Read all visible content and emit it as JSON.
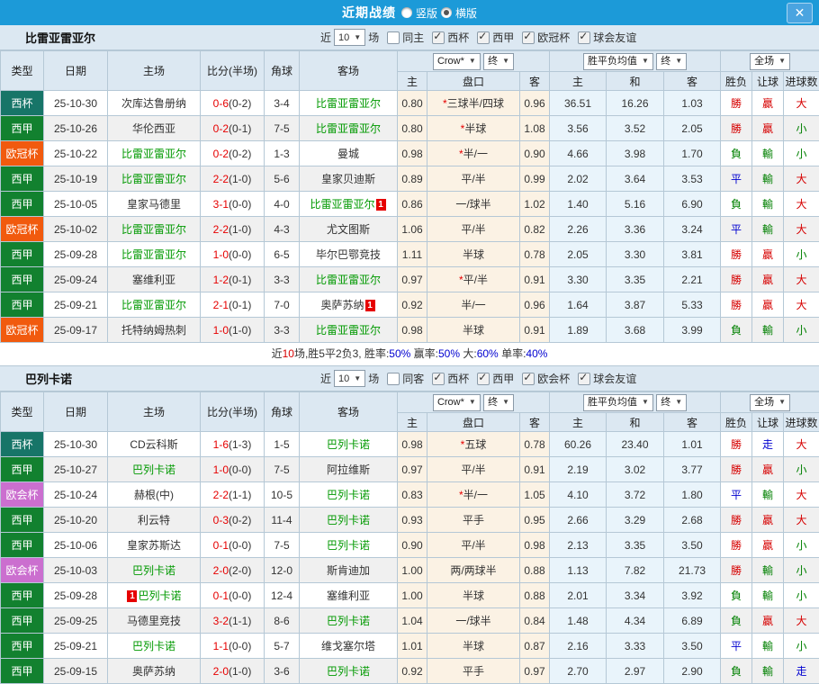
{
  "titlebar": {
    "title": "近期战绩",
    "vertical_label": "竖版",
    "horizontal_label": "横版",
    "close_label": "✕"
  },
  "columns": {
    "type": "类型",
    "date": "日期",
    "home": "主场",
    "score": "比分(半场)",
    "corner": "角球",
    "away": "客场",
    "odds_provider": "Crow*",
    "final1": "终",
    "avg_label": "胜平负均值",
    "final2": "终",
    "scope": "全场",
    "odds_home": "主",
    "handicap": "盘口",
    "odds_away": "客",
    "avg_home": "主",
    "avg_draw": "和",
    "avg_away": "客",
    "result": "胜负",
    "let_result": "让球",
    "goals": "进球数"
  },
  "colors": {
    "titlebar_bg": "#1c9ad8",
    "header_bg": "#dce8f2",
    "border": "#b5c8d6",
    "focus_team_green": "#009900",
    "red": "#e60000",
    "result_red": "#d60000",
    "result_green": "#008000",
    "result_blue": "#0000d0",
    "odds_bg": "#fbf2e4",
    "avg_bg": "#e9f4fb",
    "zebra": "#f0f0f0",
    "type_colors": {
      "西杯": "#177568",
      "西甲": "#12812f",
      "欧冠杯": "#f15a0e",
      "欧会杯": "#cb6fcf"
    }
  },
  "sections": [
    {
      "team": "比雷亚雷亚尔",
      "filter": {
        "near": "近",
        "games_count": "10",
        "games_unit": "场",
        "same_venue": "同主",
        "same_venue_checked": false,
        "leagues": [
          "西杯",
          "西甲",
          "欧冠杯",
          "球会友谊"
        ]
      },
      "rows": [
        {
          "type": "西杯",
          "date": "25-10-30",
          "home": {
            "name": "次库达鲁册纳",
            "green": false
          },
          "score": {
            "full": "0-6",
            "half": "(0-2)"
          },
          "corner": "3-4",
          "away": {
            "name": "比雷亚雷亚尔",
            "green": true
          },
          "odds": {
            "home": "0.80",
            "star": true,
            "handicap": "三球半/四球",
            "away": "0.96"
          },
          "avg": {
            "home": "36.51",
            "draw": "16.26",
            "away": "1.03"
          },
          "result": {
            "wdl": "勝",
            "wdl_c": "red",
            "let": "贏",
            "let_c": "red",
            "goals": "大",
            "goals_c": "red"
          }
        },
        {
          "type": "西甲",
          "date": "25-10-26",
          "home": {
            "name": "华伦西亚",
            "green": false
          },
          "score": {
            "full": "0-2",
            "half": "(0-1)"
          },
          "corner": "7-5",
          "away": {
            "name": "比雷亚雷亚尔",
            "green": true
          },
          "odds": {
            "home": "0.80",
            "star": true,
            "handicap": "半球",
            "away": "1.08"
          },
          "avg": {
            "home": "3.56",
            "draw": "3.52",
            "away": "2.05"
          },
          "result": {
            "wdl": "勝",
            "wdl_c": "red",
            "let": "贏",
            "let_c": "red",
            "goals": "小",
            "goals_c": "green"
          }
        },
        {
          "type": "欧冠杯",
          "date": "25-10-22",
          "home": {
            "name": "比雷亚雷亚尔",
            "green": true
          },
          "score": {
            "full": "0-2",
            "half": "(0-2)"
          },
          "corner": "1-3",
          "away": {
            "name": "曼城",
            "green": false
          },
          "odds": {
            "home": "0.98",
            "star": true,
            "handicap": "半/一",
            "away": "0.90"
          },
          "avg": {
            "home": "4.66",
            "draw": "3.98",
            "away": "1.70"
          },
          "result": {
            "wdl": "負",
            "wdl_c": "green",
            "let": "輸",
            "let_c": "green",
            "goals": "小",
            "goals_c": "green"
          }
        },
        {
          "type": "西甲",
          "date": "25-10-19",
          "home": {
            "name": "比雷亚雷亚尔",
            "green": true
          },
          "score": {
            "full": "2-2",
            "half": "(1-0)"
          },
          "corner": "5-6",
          "away": {
            "name": "皇家贝迪斯",
            "green": false
          },
          "odds": {
            "home": "0.89",
            "star": false,
            "handicap": "平/半",
            "away": "0.99"
          },
          "avg": {
            "home": "2.02",
            "draw": "3.64",
            "away": "3.53"
          },
          "result": {
            "wdl": "平",
            "wdl_c": "blue",
            "let": "輸",
            "let_c": "green",
            "goals": "大",
            "goals_c": "red"
          }
        },
        {
          "type": "西甲",
          "date": "25-10-05",
          "home": {
            "name": "皇家马德里",
            "green": false
          },
          "score": {
            "full": "3-1",
            "half": "(0-0)"
          },
          "corner": "4-0",
          "away": {
            "name": "比雷亚雷亚尔",
            "green": true,
            "badge": "1",
            "badge_pos": "after"
          },
          "odds": {
            "home": "0.86",
            "star": false,
            "handicap": "一/球半",
            "away": "1.02"
          },
          "avg": {
            "home": "1.40",
            "draw": "5.16",
            "away": "6.90"
          },
          "result": {
            "wdl": "負",
            "wdl_c": "green",
            "let": "輸",
            "let_c": "green",
            "goals": "大",
            "goals_c": "red"
          }
        },
        {
          "type": "欧冠杯",
          "date": "25-10-02",
          "home": {
            "name": "比雷亚雷亚尔",
            "green": true
          },
          "score": {
            "full": "2-2",
            "half": "(1-0)"
          },
          "corner": "4-3",
          "away": {
            "name": "尤文图斯",
            "green": false
          },
          "odds": {
            "home": "1.06",
            "star": false,
            "handicap": "平/半",
            "away": "0.82"
          },
          "avg": {
            "home": "2.26",
            "draw": "3.36",
            "away": "3.24"
          },
          "result": {
            "wdl": "平",
            "wdl_c": "blue",
            "let": "輸",
            "let_c": "green",
            "goals": "大",
            "goals_c": "red"
          }
        },
        {
          "type": "西甲",
          "date": "25-09-28",
          "home": {
            "name": "比雷亚雷亚尔",
            "green": true
          },
          "score": {
            "full": "1-0",
            "half": "(0-0)"
          },
          "corner": "6-5",
          "away": {
            "name": "毕尔巴鄂竞技",
            "green": false
          },
          "odds": {
            "home": "1.11",
            "star": false,
            "handicap": "半球",
            "away": "0.78"
          },
          "avg": {
            "home": "2.05",
            "draw": "3.30",
            "away": "3.81"
          },
          "result": {
            "wdl": "勝",
            "wdl_c": "red",
            "let": "贏",
            "let_c": "red",
            "goals": "小",
            "goals_c": "green"
          }
        },
        {
          "type": "西甲",
          "date": "25-09-24",
          "home": {
            "name": "塞维利亚",
            "green": false
          },
          "score": {
            "full": "1-2",
            "half": "(0-1)"
          },
          "corner": "3-3",
          "away": {
            "name": "比雷亚雷亚尔",
            "green": true
          },
          "odds": {
            "home": "0.97",
            "star": true,
            "handicap": "平/半",
            "away": "0.91"
          },
          "avg": {
            "home": "3.30",
            "draw": "3.35",
            "away": "2.21"
          },
          "result": {
            "wdl": "勝",
            "wdl_c": "red",
            "let": "贏",
            "let_c": "red",
            "goals": "大",
            "goals_c": "red"
          }
        },
        {
          "type": "西甲",
          "date": "25-09-21",
          "home": {
            "name": "比雷亚雷亚尔",
            "green": true
          },
          "score": {
            "full": "2-1",
            "half": "(0-1)"
          },
          "corner": "7-0",
          "away": {
            "name": "奥萨苏纳",
            "green": false,
            "badge": "1",
            "badge_pos": "after"
          },
          "odds": {
            "home": "0.92",
            "star": false,
            "handicap": "半/一",
            "away": "0.96"
          },
          "avg": {
            "home": "1.64",
            "draw": "3.87",
            "away": "5.33"
          },
          "result": {
            "wdl": "勝",
            "wdl_c": "red",
            "let": "贏",
            "let_c": "red",
            "goals": "大",
            "goals_c": "red"
          }
        },
        {
          "type": "欧冠杯",
          "date": "25-09-17",
          "home": {
            "name": "托特纳姆热刺",
            "green": false
          },
          "score": {
            "full": "1-0",
            "half": "(1-0)"
          },
          "corner": "3-3",
          "away": {
            "name": "比雷亚雷亚尔",
            "green": true
          },
          "odds": {
            "home": "0.98",
            "star": false,
            "handicap": "半球",
            "away": "0.91"
          },
          "avg": {
            "home": "1.89",
            "draw": "3.68",
            "away": "3.99"
          },
          "result": {
            "wdl": "負",
            "wdl_c": "green",
            "let": "輸",
            "let_c": "green",
            "goals": "小",
            "goals_c": "green"
          }
        }
      ],
      "summary": [
        {
          "text": "近",
          "c": "dark"
        },
        {
          "text": "10",
          "c": "red"
        },
        {
          "text": "场,胜5平2负3, 胜率:",
          "c": "dark"
        },
        {
          "text": "50%",
          "c": "blue"
        },
        {
          "text": " 赢率:",
          "c": "dark"
        },
        {
          "text": "50%",
          "c": "blue"
        },
        {
          "text": " 大:",
          "c": "dark"
        },
        {
          "text": "60%",
          "c": "blue"
        },
        {
          "text": " 单率:",
          "c": "dark"
        },
        {
          "text": "40%",
          "c": "blue"
        }
      ]
    },
    {
      "team": "巴列卡诺",
      "filter": {
        "near": "近",
        "games_count": "10",
        "games_unit": "场",
        "same_venue": "同客",
        "same_venue_checked": false,
        "leagues": [
          "西杯",
          "西甲",
          "欧会杯",
          "球会友谊"
        ]
      },
      "rows": [
        {
          "type": "西杯",
          "date": "25-10-30",
          "home": {
            "name": "CD云科斯",
            "green": false
          },
          "score": {
            "full": "1-6",
            "half": "(1-3)"
          },
          "corner": "1-5",
          "away": {
            "name": "巴列卡诺",
            "green": true
          },
          "odds": {
            "home": "0.98",
            "star": true,
            "handicap": "五球",
            "away": "0.78"
          },
          "avg": {
            "home": "60.26",
            "draw": "23.40",
            "away": "1.01"
          },
          "result": {
            "wdl": "勝",
            "wdl_c": "red",
            "let": "走",
            "let_c": "blue",
            "goals": "大",
            "goals_c": "red"
          }
        },
        {
          "type": "西甲",
          "date": "25-10-27",
          "home": {
            "name": "巴列卡诺",
            "green": true
          },
          "score": {
            "full": "1-0",
            "half": "(0-0)"
          },
          "corner": "7-5",
          "away": {
            "name": "阿拉维斯",
            "green": false
          },
          "odds": {
            "home": "0.97",
            "star": false,
            "handicap": "平/半",
            "away": "0.91"
          },
          "avg": {
            "home": "2.19",
            "draw": "3.02",
            "away": "3.77"
          },
          "result": {
            "wdl": "勝",
            "wdl_c": "red",
            "let": "贏",
            "let_c": "red",
            "goals": "小",
            "goals_c": "green"
          }
        },
        {
          "type": "欧会杯",
          "date": "25-10-24",
          "home": {
            "name": "赫根(中)",
            "green": false
          },
          "score": {
            "full": "2-2",
            "half": "(1-1)"
          },
          "corner": "10-5",
          "away": {
            "name": "巴列卡诺",
            "green": true
          },
          "odds": {
            "home": "0.83",
            "star": true,
            "handicap": "半/一",
            "away": "1.05"
          },
          "avg": {
            "home": "4.10",
            "draw": "3.72",
            "away": "1.80"
          },
          "result": {
            "wdl": "平",
            "wdl_c": "blue",
            "let": "輸",
            "let_c": "green",
            "goals": "大",
            "goals_c": "red"
          }
        },
        {
          "type": "西甲",
          "date": "25-10-20",
          "home": {
            "name": "利云特",
            "green": false
          },
          "score": {
            "full": "0-3",
            "half": "(0-2)"
          },
          "corner": "11-4",
          "away": {
            "name": "巴列卡诺",
            "green": true
          },
          "odds": {
            "home": "0.93",
            "star": false,
            "handicap": "平手",
            "away": "0.95"
          },
          "avg": {
            "home": "2.66",
            "draw": "3.29",
            "away": "2.68"
          },
          "result": {
            "wdl": "勝",
            "wdl_c": "red",
            "let": "贏",
            "let_c": "red",
            "goals": "大",
            "goals_c": "red"
          }
        },
        {
          "type": "西甲",
          "date": "25-10-06",
          "home": {
            "name": "皇家苏斯达",
            "green": false
          },
          "score": {
            "full": "0-1",
            "half": "(0-0)"
          },
          "corner": "7-5",
          "away": {
            "name": "巴列卡诺",
            "green": true
          },
          "odds": {
            "home": "0.90",
            "star": false,
            "handicap": "平/半",
            "away": "0.98"
          },
          "avg": {
            "home": "2.13",
            "draw": "3.35",
            "away": "3.50"
          },
          "result": {
            "wdl": "勝",
            "wdl_c": "red",
            "let": "贏",
            "let_c": "red",
            "goals": "小",
            "goals_c": "green"
          }
        },
        {
          "type": "欧会杯",
          "date": "25-10-03",
          "home": {
            "name": "巴列卡诺",
            "green": true
          },
          "score": {
            "full": "2-0",
            "half": "(2-0)"
          },
          "corner": "12-0",
          "away": {
            "name": "斯肯迪加",
            "green": false
          },
          "odds": {
            "home": "1.00",
            "star": false,
            "handicap": "两/两球半",
            "away": "0.88"
          },
          "avg": {
            "home": "1.13",
            "draw": "7.82",
            "away": "21.73"
          },
          "result": {
            "wdl": "勝",
            "wdl_c": "red",
            "let": "輸",
            "let_c": "green",
            "goals": "小",
            "goals_c": "green"
          }
        },
        {
          "type": "西甲",
          "date": "25-09-28",
          "home": {
            "name": "巴列卡诺",
            "green": true,
            "badge": "1",
            "badge_pos": "before"
          },
          "score": {
            "full": "0-1",
            "half": "(0-0)"
          },
          "corner": "12-4",
          "away": {
            "name": "塞维利亚",
            "green": false
          },
          "odds": {
            "home": "1.00",
            "star": false,
            "handicap": "半球",
            "away": "0.88"
          },
          "avg": {
            "home": "2.01",
            "draw": "3.34",
            "away": "3.92"
          },
          "result": {
            "wdl": "負",
            "wdl_c": "green",
            "let": "輸",
            "let_c": "green",
            "goals": "小",
            "goals_c": "green"
          }
        },
        {
          "type": "西甲",
          "date": "25-09-25",
          "home": {
            "name": "马德里竞技",
            "green": false
          },
          "score": {
            "full": "3-2",
            "half": "(1-1)"
          },
          "corner": "8-6",
          "away": {
            "name": "巴列卡诺",
            "green": true
          },
          "odds": {
            "home": "1.04",
            "star": false,
            "handicap": "一/球半",
            "away": "0.84"
          },
          "avg": {
            "home": "1.48",
            "draw": "4.34",
            "away": "6.89"
          },
          "result": {
            "wdl": "負",
            "wdl_c": "green",
            "let": "贏",
            "let_c": "red",
            "goals": "大",
            "goals_c": "red"
          }
        },
        {
          "type": "西甲",
          "date": "25-09-21",
          "home": {
            "name": "巴列卡诺",
            "green": true
          },
          "score": {
            "full": "1-1",
            "half": "(0-0)"
          },
          "corner": "5-7",
          "away": {
            "name": "维戈塞尔塔",
            "green": false
          },
          "odds": {
            "home": "1.01",
            "star": false,
            "handicap": "半球",
            "away": "0.87"
          },
          "avg": {
            "home": "2.16",
            "draw": "3.33",
            "away": "3.50"
          },
          "result": {
            "wdl": "平",
            "wdl_c": "blue",
            "let": "輸",
            "let_c": "green",
            "goals": "小",
            "goals_c": "green"
          }
        },
        {
          "type": "西甲",
          "date": "25-09-15",
          "home": {
            "name": "奥萨苏纳",
            "green": false
          },
          "score": {
            "full": "2-0",
            "half": "(1-0)"
          },
          "corner": "3-6",
          "away": {
            "name": "巴列卡诺",
            "green": true
          },
          "odds": {
            "home": "0.92",
            "star": false,
            "handicap": "平手",
            "away": "0.97"
          },
          "avg": {
            "home": "2.70",
            "draw": "2.97",
            "away": "2.90"
          },
          "result": {
            "wdl": "負",
            "wdl_c": "green",
            "let": "輸",
            "let_c": "green",
            "goals": "走",
            "goals_c": "blue"
          }
        }
      ],
      "summary": null
    }
  ]
}
